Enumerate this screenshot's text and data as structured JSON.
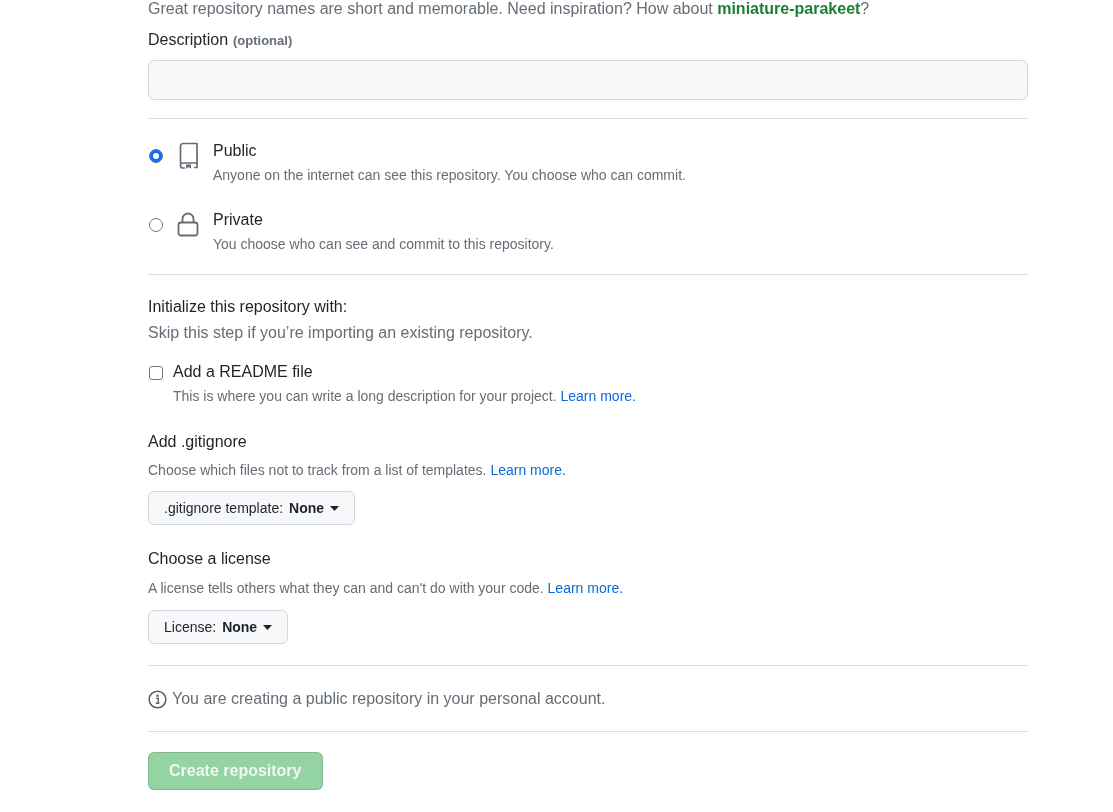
{
  "name_hint": {
    "text": "Great repository names are short and memorable. Need inspiration? How about",
    "suggestion": "miniature-parakeet",
    "after": "?"
  },
  "description": {
    "label": "Description",
    "note": "(optional)"
  },
  "visibility": [
    {
      "kind": "public",
      "title": "Public",
      "text": "Anyone on the internet can see this repository. You choose who can commit.",
      "selected": true
    },
    {
      "kind": "private",
      "title": "Private",
      "text": "You choose who can see and commit to this repository.",
      "selected": false
    }
  ],
  "initialize": {
    "title": "Initialize this repository with:",
    "subtitle": "Skip this step if you’re importing an existing repository.",
    "readme": {
      "label": "Add a README file",
      "checked": false,
      "text": "This is where you can write a long description for your project.",
      "link": "Learn more."
    }
  },
  "gitignore": {
    "title": "Add .gitignore",
    "text": "Choose which files not to track from a list of templates.",
    "link": "Learn more.",
    "dropdown": {
      "label": ".gitignore template:",
      "value": "None"
    }
  },
  "license": {
    "title": "Choose a license",
    "text": "A license tells others what they can and can't do with your code.",
    "link": "Learn more.",
    "dropdown": {
      "label": "License:",
      "value": "None"
    }
  },
  "notice": "You are creating a public repository in your personal account.",
  "submit": {
    "label": "Create repository",
    "disabled": true
  }
}
